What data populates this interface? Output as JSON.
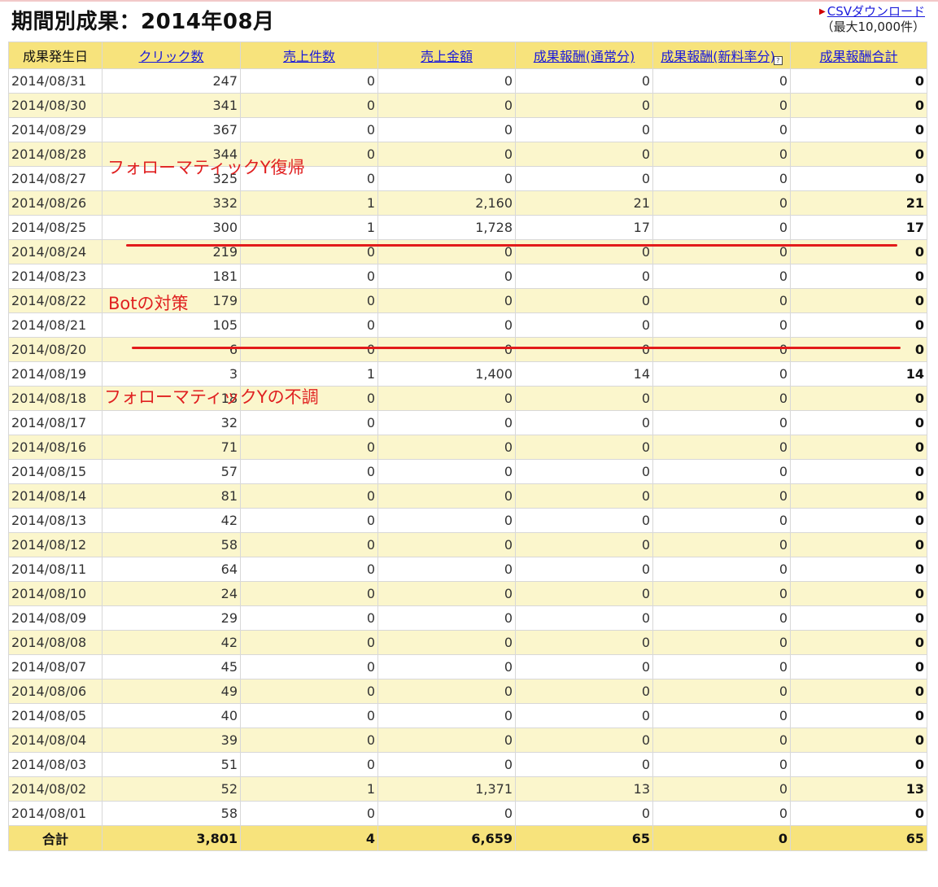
{
  "title": "期間別成果：2014年08月",
  "csv": {
    "link": "CSVダウンロード",
    "note": "（最大10,000件）"
  },
  "headers": [
    {
      "label": "成果発生日",
      "link": false
    },
    {
      "label": "クリック数",
      "link": true
    },
    {
      "label": "売上件数",
      "link": true
    },
    {
      "label": "売上金額",
      "link": true
    },
    {
      "label": "成果報酬(通常分)",
      "link": true
    },
    {
      "label": "成果報酬(新料率分)",
      "link": true,
      "help": "?"
    },
    {
      "label": "成果報酬合計",
      "link": true
    }
  ],
  "rows": [
    [
      "2014/08/31",
      "247",
      "0",
      "0",
      "0",
      "0",
      "0"
    ],
    [
      "2014/08/30",
      "341",
      "0",
      "0",
      "0",
      "0",
      "0"
    ],
    [
      "2014/08/29",
      "367",
      "0",
      "0",
      "0",
      "0",
      "0"
    ],
    [
      "2014/08/28",
      "344",
      "0",
      "0",
      "0",
      "0",
      "0"
    ],
    [
      "2014/08/27",
      "325",
      "0",
      "0",
      "0",
      "0",
      "0"
    ],
    [
      "2014/08/26",
      "332",
      "1",
      "2,160",
      "21",
      "0",
      "21"
    ],
    [
      "2014/08/25",
      "300",
      "1",
      "1,728",
      "17",
      "0",
      "17"
    ],
    [
      "2014/08/24",
      "219",
      "0",
      "0",
      "0",
      "0",
      "0"
    ],
    [
      "2014/08/23",
      "181",
      "0",
      "0",
      "0",
      "0",
      "0"
    ],
    [
      "2014/08/22",
      "179",
      "0",
      "0",
      "0",
      "0",
      "0"
    ],
    [
      "2014/08/21",
      "105",
      "0",
      "0",
      "0",
      "0",
      "0"
    ],
    [
      "2014/08/20",
      "6",
      "0",
      "0",
      "0",
      "0",
      "0"
    ],
    [
      "2014/08/19",
      "3",
      "1",
      "1,400",
      "14",
      "0",
      "14"
    ],
    [
      "2014/08/18",
      "18",
      "0",
      "0",
      "0",
      "0",
      "0"
    ],
    [
      "2014/08/17",
      "32",
      "0",
      "0",
      "0",
      "0",
      "0"
    ],
    [
      "2014/08/16",
      "71",
      "0",
      "0",
      "0",
      "0",
      "0"
    ],
    [
      "2014/08/15",
      "57",
      "0",
      "0",
      "0",
      "0",
      "0"
    ],
    [
      "2014/08/14",
      "81",
      "0",
      "0",
      "0",
      "0",
      "0"
    ],
    [
      "2014/08/13",
      "42",
      "0",
      "0",
      "0",
      "0",
      "0"
    ],
    [
      "2014/08/12",
      "58",
      "0",
      "0",
      "0",
      "0",
      "0"
    ],
    [
      "2014/08/11",
      "64",
      "0",
      "0",
      "0",
      "0",
      "0"
    ],
    [
      "2014/08/10",
      "24",
      "0",
      "0",
      "0",
      "0",
      "0"
    ],
    [
      "2014/08/09",
      "29",
      "0",
      "0",
      "0",
      "0",
      "0"
    ],
    [
      "2014/08/08",
      "42",
      "0",
      "0",
      "0",
      "0",
      "0"
    ],
    [
      "2014/08/07",
      "45",
      "0",
      "0",
      "0",
      "0",
      "0"
    ],
    [
      "2014/08/06",
      "49",
      "0",
      "0",
      "0",
      "0",
      "0"
    ],
    [
      "2014/08/05",
      "40",
      "0",
      "0",
      "0",
      "0",
      "0"
    ],
    [
      "2014/08/04",
      "39",
      "0",
      "0",
      "0",
      "0",
      "0"
    ],
    [
      "2014/08/03",
      "51",
      "0",
      "0",
      "0",
      "0",
      "0"
    ],
    [
      "2014/08/02",
      "52",
      "1",
      "1,371",
      "13",
      "0",
      "13"
    ],
    [
      "2014/08/01",
      "58",
      "0",
      "0",
      "0",
      "0",
      "0"
    ]
  ],
  "total": [
    "合計",
    "3,801",
    "4",
    "6,659",
    "65",
    "0",
    "65"
  ],
  "annotations": {
    "recovery": "フォローマティックY復帰",
    "bot": "Botの対策",
    "malfunction": "フォローマティックYの不調"
  },
  "colors": {
    "header_bg": "#f7e37c",
    "alt_row_bg": "#fbf6cc",
    "link": "#1a1adb",
    "annotation": "#e02020"
  }
}
